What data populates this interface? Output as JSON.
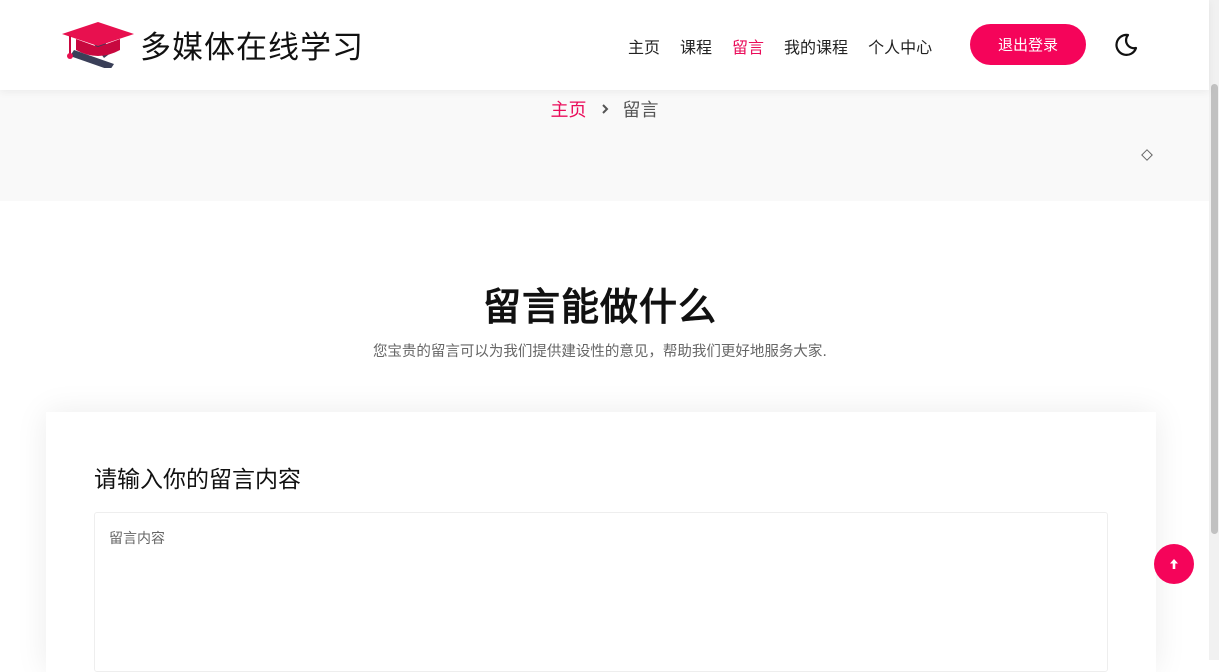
{
  "header": {
    "site_title": "多媒体在线学习",
    "nav": [
      {
        "label": "主页"
      },
      {
        "label": "课程"
      },
      {
        "label": "留言",
        "active": true
      },
      {
        "label": "我的课程"
      },
      {
        "label": "个人中心"
      }
    ],
    "logout_label": "退出登录",
    "theme_icon": "moon-icon"
  },
  "breadcrumb": {
    "home": "主页",
    "current": "留言"
  },
  "section": {
    "title": "留言能做什么",
    "subtitle": "您宝贵的留言可以为我们提供建设性的意见，帮助我们更好地服务大家."
  },
  "form": {
    "title": "请输入你的留言内容",
    "message_placeholder": "留言内容",
    "message_value": ""
  },
  "colors": {
    "accent": "#f5045a",
    "active_text": "#ea0c5a"
  }
}
